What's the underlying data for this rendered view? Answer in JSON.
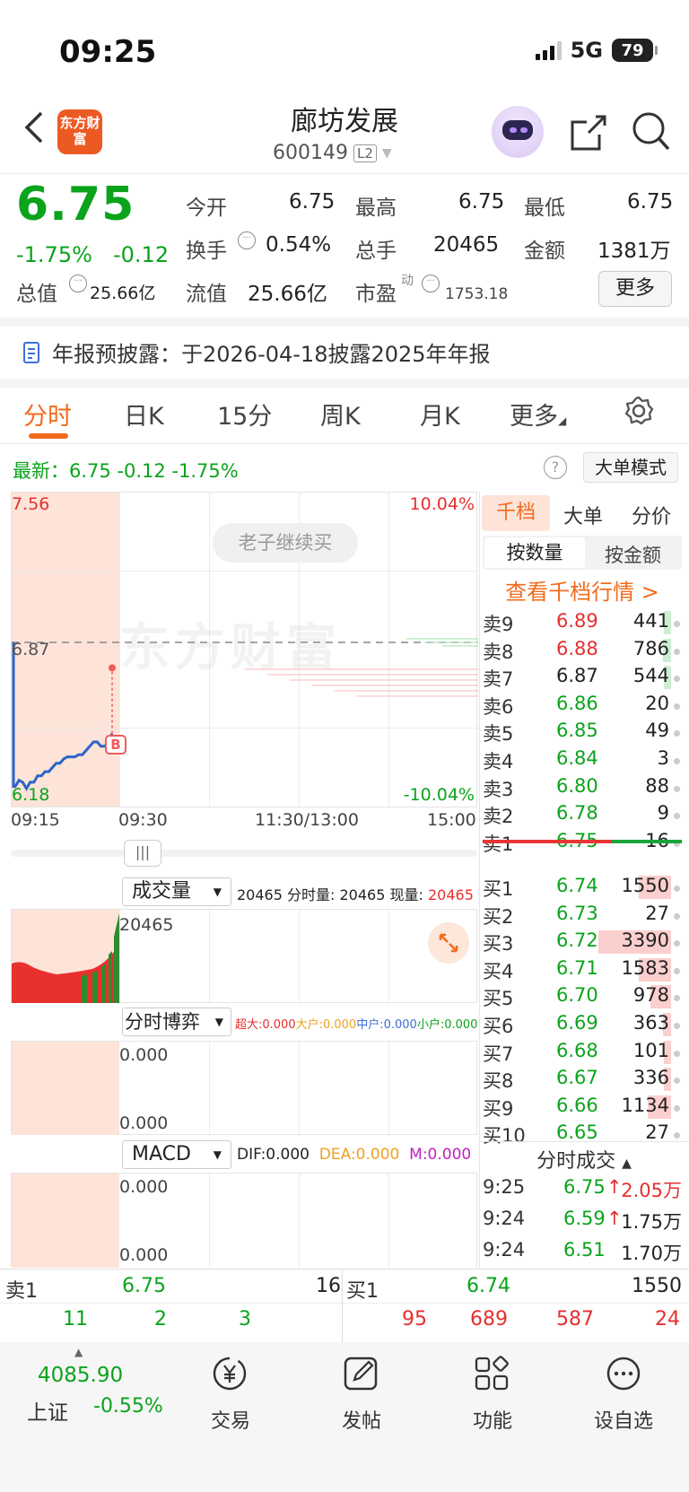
{
  "status": {
    "time": "09:25",
    "network": "5G",
    "battery": "79"
  },
  "header": {
    "title": "廊坊发展",
    "code": "600149",
    "level": "L2",
    "logo_text": "东方财富"
  },
  "quote": {
    "price": "6.75",
    "change_pct": "-1.75%",
    "change_abs": "-0.12",
    "rows": [
      [
        {
          "label": "今开",
          "value": "6.75",
          "color": "green"
        },
        {
          "label": "最高",
          "value": "6.75",
          "color": "green"
        },
        {
          "label": "最低",
          "value": "6.75",
          "color": "green"
        }
      ],
      [
        {
          "label": "换手",
          "value": "0.54%"
        },
        {
          "label": "总手",
          "value": "20465"
        },
        {
          "label": "金额",
          "value": "1381万"
        }
      ],
      [
        {
          "label": "总值",
          "value": "25.66亿"
        },
        {
          "label": "流值",
          "value": "25.66亿"
        },
        {
          "label": "市盈",
          "sup": "动",
          "value": "1753.18"
        }
      ]
    ],
    "more": "更多"
  },
  "notice": "年报预披露：于2026-04-18披露2025年年报",
  "tabs": [
    "分时",
    "日K",
    "15分",
    "周K",
    "月K",
    "更多"
  ],
  "latest": "最新：6.75  -0.12  -1.75%",
  "big_order_mode": "大单模式",
  "chart": {
    "y_top": "7.56",
    "y_bottom": "6.18",
    "y_ref": "6.87",
    "pct_top": "10.04%",
    "pct_bottom": "-10.04%",
    "times": [
      "09:15",
      "09:30",
      "11:30/13:00",
      "15:00"
    ],
    "watermark": "东方财富",
    "tip": "老子继续买",
    "b_marker": "B",
    "price_line": [
      6.19,
      6.22,
      6.21,
      6.18,
      6.21,
      6.21,
      6.24,
      6.24,
      6.26,
      6.26,
      6.28,
      6.3,
      6.3,
      6.32,
      6.33,
      6.33,
      6.33,
      6.34,
      6.34,
      6.36,
      6.38,
      6.4,
      6.4,
      6.38,
      6.38,
      6.4,
      6.44
    ],
    "trade_ref_price": 6.75
  },
  "volume": {
    "selector": "成交量",
    "summary": [
      "20465",
      "分时量: 20465",
      "现量:",
      "20465"
    ],
    "axis": "20465"
  },
  "game": {
    "selector": "分时博弈",
    "labels": [
      "超大:0.000",
      "大户:0.000",
      "中户:0.000",
      "小户:0.000"
    ],
    "top": "0.000",
    "bottom": "0.000"
  },
  "macd": {
    "selector": "MACD",
    "dif": "DIF:0.000",
    "dea": "DEA:0.000",
    "m": "M:0.000",
    "top": "0.000",
    "bottom": "0.000"
  },
  "panel": {
    "tabs": [
      "千档",
      "大单",
      "分价"
    ],
    "subtabs": [
      "按数量",
      "按金额"
    ],
    "link": "查看千档行情 >",
    "asks": [
      {
        "label": "卖9",
        "price": "6.89",
        "vol": "441",
        "c": "red",
        "bar": 0.05,
        "g": true
      },
      {
        "label": "卖8",
        "price": "6.88",
        "vol": "786",
        "c": "red",
        "bar": 0.07,
        "g": true
      },
      {
        "label": "卖7",
        "price": "6.87",
        "vol": "544",
        "c": "black",
        "bar": 0.05,
        "g": true
      },
      {
        "label": "卖6",
        "price": "6.86",
        "vol": "20",
        "c": "green",
        "bar": 0
      },
      {
        "label": "卖5",
        "price": "6.85",
        "vol": "49",
        "c": "green",
        "bar": 0
      },
      {
        "label": "卖4",
        "price": "6.84",
        "vol": "3",
        "c": "green",
        "bar": 0
      },
      {
        "label": "卖3",
        "price": "6.80",
        "vol": "88",
        "c": "green",
        "bar": 0
      },
      {
        "label": "卖2",
        "price": "6.78",
        "vol": "9",
        "c": "green",
        "bar": 0
      },
      {
        "label": "卖1",
        "price": "6.75",
        "vol": "16",
        "c": "green",
        "bar": 0
      }
    ],
    "bids": [
      {
        "label": "买1",
        "price": "6.74",
        "vol": "1550",
        "c": "green",
        "bar": 0.28
      },
      {
        "label": "买2",
        "price": "6.73",
        "vol": "27",
        "c": "green",
        "bar": 0
      },
      {
        "label": "买3",
        "price": "6.72",
        "vol": "3390",
        "c": "green",
        "bar": 0.62
      },
      {
        "label": "买4",
        "price": "6.71",
        "vol": "1583",
        "c": "green",
        "bar": 0.28
      },
      {
        "label": "买5",
        "price": "6.70",
        "vol": "978",
        "c": "green",
        "bar": 0.18
      },
      {
        "label": "买6",
        "price": "6.69",
        "vol": "363",
        "c": "green",
        "bar": 0.07
      },
      {
        "label": "买7",
        "price": "6.68",
        "vol": "101",
        "c": "green",
        "bar": 0.02
      },
      {
        "label": "买8",
        "price": "6.67",
        "vol": "336",
        "c": "green",
        "bar": 0.06
      },
      {
        "label": "买9",
        "price": "6.66",
        "vol": "1134",
        "c": "green",
        "bar": 0.2
      },
      {
        "label": "买10",
        "price": "6.65",
        "vol": "27",
        "c": "green",
        "bar": 0
      }
    ],
    "ticks_title": "分时成交",
    "ticks": [
      {
        "time": "9:25",
        "price": "6.75",
        "arrow": "↑",
        "vol": "2.05万",
        "vc": "red"
      },
      {
        "time": "9:24",
        "price": "6.59",
        "arrow": "↑",
        "vol": "1.75万",
        "vc": "black"
      },
      {
        "time": "9:24",
        "price": "6.51",
        "arrow": "",
        "vol": "1.70万",
        "vc": "black"
      }
    ]
  },
  "bottom_quote": {
    "sell": {
      "label": "卖1",
      "price": "6.75",
      "vol": "16"
    },
    "buy": {
      "label": "买1",
      "price": "6.74",
      "vol": "1550"
    },
    "left_nums": [
      "11",
      "2",
      "3"
    ],
    "right_nums": [
      "95",
      "689",
      "587",
      "24"
    ]
  },
  "nav": {
    "index_value": "4085.90",
    "index_name": "上证",
    "index_change": "-0.55%",
    "items": [
      {
        "label": "交易",
        "icon": "yen-exchange-icon"
      },
      {
        "label": "发帖",
        "icon": "edit-icon"
      },
      {
        "label": "功能",
        "icon": "grid-icon"
      },
      {
        "label": "设自选",
        "icon": "more-circle-icon"
      }
    ]
  }
}
